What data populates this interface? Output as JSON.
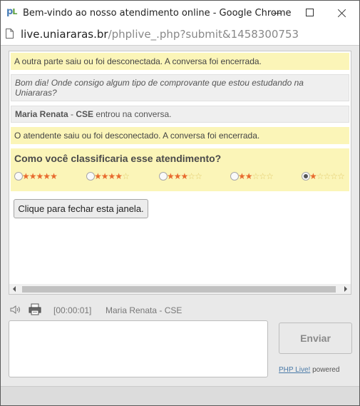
{
  "window": {
    "title": "Bem-vindo ao nosso atendimento online - Google Chrome",
    "icon_text_p": "p",
    "icon_text_l": "L"
  },
  "address": {
    "host": "live.uniararas.br",
    "path": "/phplive_.php?submit&1458300753"
  },
  "chat": {
    "messages": [
      {
        "type": "system",
        "text": "A outra parte saiu ou foi desconectada. A conversa foi encerrada."
      },
      {
        "type": "visitor",
        "text": "Bom dia! Onde consigo algum tipo de comprovante que estou estudando na Uniararas?"
      },
      {
        "type": "join",
        "name": "Maria Renata",
        "dept": "CSE",
        "separator": " - ",
        "text": " entrou na conversa."
      },
      {
        "type": "system",
        "text": "O atendente saiu ou foi desconectado. A conversa foi encerrada."
      }
    ],
    "rating": {
      "question": "Como você classificaria esse atendimento?",
      "options": [
        {
          "stars": 5,
          "selected": false
        },
        {
          "stars": 4,
          "selected": false
        },
        {
          "stars": 3,
          "selected": false
        },
        {
          "stars": 2,
          "selected": false
        },
        {
          "stars": 1,
          "selected": true
        }
      ],
      "colors": {
        "star_on": "#e86a2e",
        "star_off": "#e2c96a"
      }
    },
    "close_button_label": "Clique para fechar esta janela."
  },
  "status": {
    "sound_icon": "speaker-icon",
    "print_icon": "printer-icon",
    "timer": "[00:00:01]",
    "agent": "Maria Renata - CSE"
  },
  "composer": {
    "placeholder": "",
    "send_label": "Enviar",
    "powered_link": "PHP Live!",
    "powered_text": " powered"
  }
}
